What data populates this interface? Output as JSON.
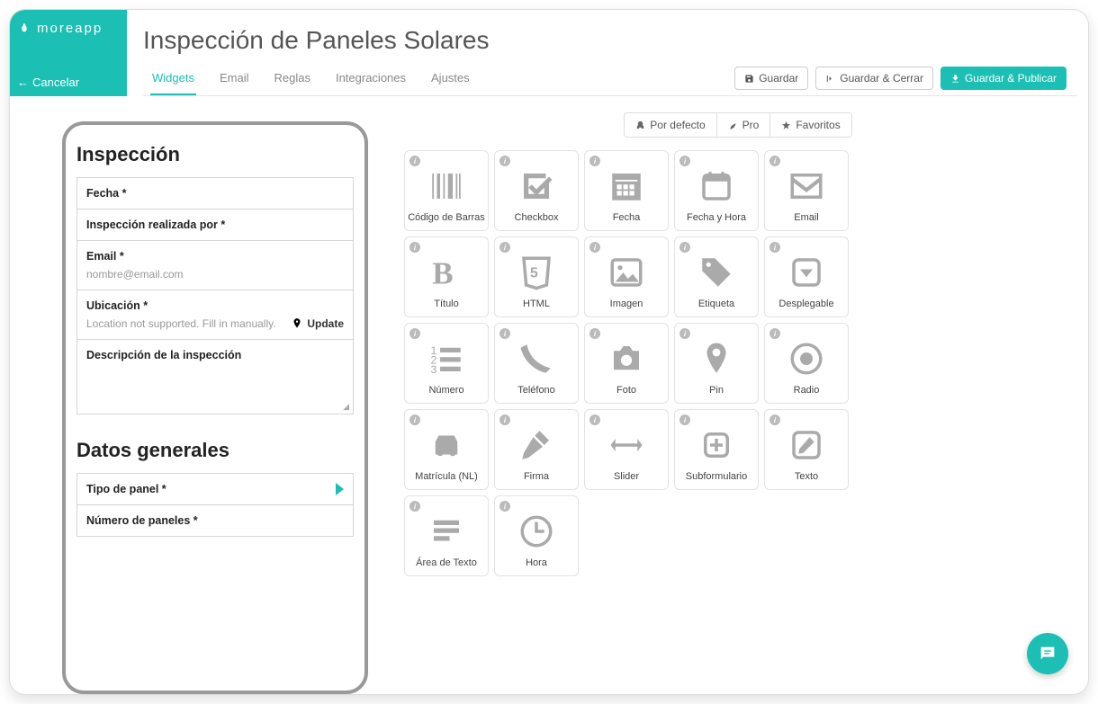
{
  "brand": "moreapp",
  "cancel": "Cancelar",
  "page_title": "Inspección de Paneles Solares",
  "tabs": [
    "Widgets",
    "Email",
    "Reglas",
    "Integraciones",
    "Ajustes"
  ],
  "active_tab": 0,
  "actions": {
    "save": "Guardar",
    "save_close": "Guardar & Cerrar",
    "save_publish": "Guardar & Publicar"
  },
  "filters": {
    "default": "Por defecto",
    "pro": "Pro",
    "fav": "Favoritos"
  },
  "preview": {
    "section1_title": "Inspección",
    "fields": [
      {
        "label": "Fecha *"
      },
      {
        "label": "Inspección realizada por *"
      },
      {
        "label": "Email *",
        "placeholder": "nombre@email.com"
      },
      {
        "label": "Ubicación *",
        "loc_hint": "Location not supported. Fill in manually.",
        "update": "Update"
      },
      {
        "label": "Descripción de la inspección",
        "tall": true
      }
    ],
    "section2_title": "Datos generales",
    "fields2": [
      {
        "label": "Tipo de panel *",
        "chevron": true
      },
      {
        "label": "Número de paneles *"
      }
    ]
  },
  "widgets": [
    {
      "id": "barcode",
      "label": "Código de Barras"
    },
    {
      "id": "checkbox",
      "label": "Checkbox"
    },
    {
      "id": "date",
      "label": "Fecha"
    },
    {
      "id": "datetime",
      "label": "Fecha y Hora"
    },
    {
      "id": "email",
      "label": "Email"
    },
    {
      "id": "heading",
      "label": "Título"
    },
    {
      "id": "html",
      "label": "HTML"
    },
    {
      "id": "image",
      "label": "Imagen"
    },
    {
      "id": "tag",
      "label": "Etiqueta"
    },
    {
      "id": "select",
      "label": "Desplegable"
    },
    {
      "id": "number",
      "label": "Número"
    },
    {
      "id": "phone",
      "label": "Teléfono"
    },
    {
      "id": "photo",
      "label": "Foto"
    },
    {
      "id": "pin",
      "label": "Pin"
    },
    {
      "id": "radio",
      "label": "Radio"
    },
    {
      "id": "plate",
      "label": "Matrícula (NL)"
    },
    {
      "id": "sign",
      "label": "Firma"
    },
    {
      "id": "slider",
      "label": "Slider"
    },
    {
      "id": "subform",
      "label": "Subformulario"
    },
    {
      "id": "text",
      "label": "Texto"
    },
    {
      "id": "textarea",
      "label": "Área de Texto"
    },
    {
      "id": "time",
      "label": "Hora"
    }
  ]
}
